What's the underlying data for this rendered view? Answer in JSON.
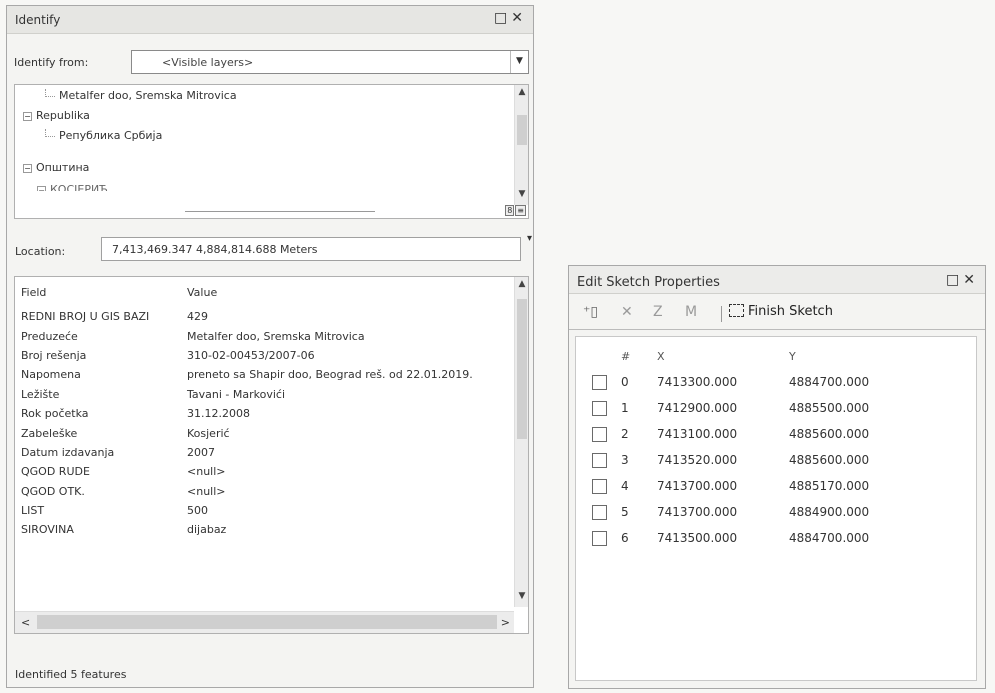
{
  "identify": {
    "title": "Identify",
    "identify_from_label": "Identify from:",
    "identify_from_value": "<Visible layers>",
    "tree": [
      {
        "label": "Metalfer doo, Sremska Mitrovica",
        "level": 2,
        "expander": ""
      },
      {
        "label": "Republika",
        "level": 0,
        "expander": "−"
      },
      {
        "label": "Република Србија",
        "level": 2,
        "expander": ""
      },
      {
        "label": "Општина",
        "level": 0,
        "expander": "−"
      },
      {
        "label": "КОСЈЕРИЋ",
        "level": 1,
        "expander": "−"
      }
    ],
    "location_label": "Location:",
    "location_value": "7,413,469.347  4,884,814.688 Meters",
    "columns": {
      "field": "Field",
      "value": "Value"
    },
    "rows": [
      {
        "field": "REDNI BROJ U GIS BAZI",
        "value": "429"
      },
      {
        "field": "Preduzeće",
        "value": "Metalfer doo, Sremska Mitrovica"
      },
      {
        "field": "Broj rešenja",
        "value": "310-02-00453/2007-06"
      },
      {
        "field": "Napomena",
        "value": "preneto sa Shapir doo, Beograd reš. od 22.01.2019."
      },
      {
        "field": "Ležište",
        "value": "Tavani - Markovići"
      },
      {
        "field": "Rok početka",
        "value": "31.12.2008"
      },
      {
        "field": "Zabeleške",
        "value": "Kosjerić"
      },
      {
        "field": "Datum izdavanja",
        "value": "2007"
      },
      {
        "field": "QGOD RUDE",
        "value": "<null>"
      },
      {
        "field": "QGOD OTK.",
        "value": "<null>"
      },
      {
        "field": "LIST",
        "value": "500"
      },
      {
        "field": "SIROVINA",
        "value": "dijabaz"
      }
    ],
    "status": "Identified 5 features"
  },
  "sketch": {
    "title": "Edit Sketch Properties",
    "finish_label": "Finish Sketch",
    "toolbar_icons": [
      "insert-vertex-icon",
      "delete-vertex-icon",
      "z-values-icon",
      "m-values-icon"
    ],
    "columns": {
      "num": "#",
      "x": "X",
      "y": "Y"
    },
    "vertices": [
      {
        "num": "0",
        "x": "7413300.000",
        "y": "4884700.000"
      },
      {
        "num": "1",
        "x": "7412900.000",
        "y": "4885500.000"
      },
      {
        "num": "2",
        "x": "7413100.000",
        "y": "4885600.000"
      },
      {
        "num": "3",
        "x": "7413520.000",
        "y": "4885600.000"
      },
      {
        "num": "4",
        "x": "7413700.000",
        "y": "4885170.000"
      },
      {
        "num": "5",
        "x": "7413700.000",
        "y": "4884900.000"
      },
      {
        "num": "6",
        "x": "7413500.000",
        "y": "4884700.000"
      }
    ]
  }
}
